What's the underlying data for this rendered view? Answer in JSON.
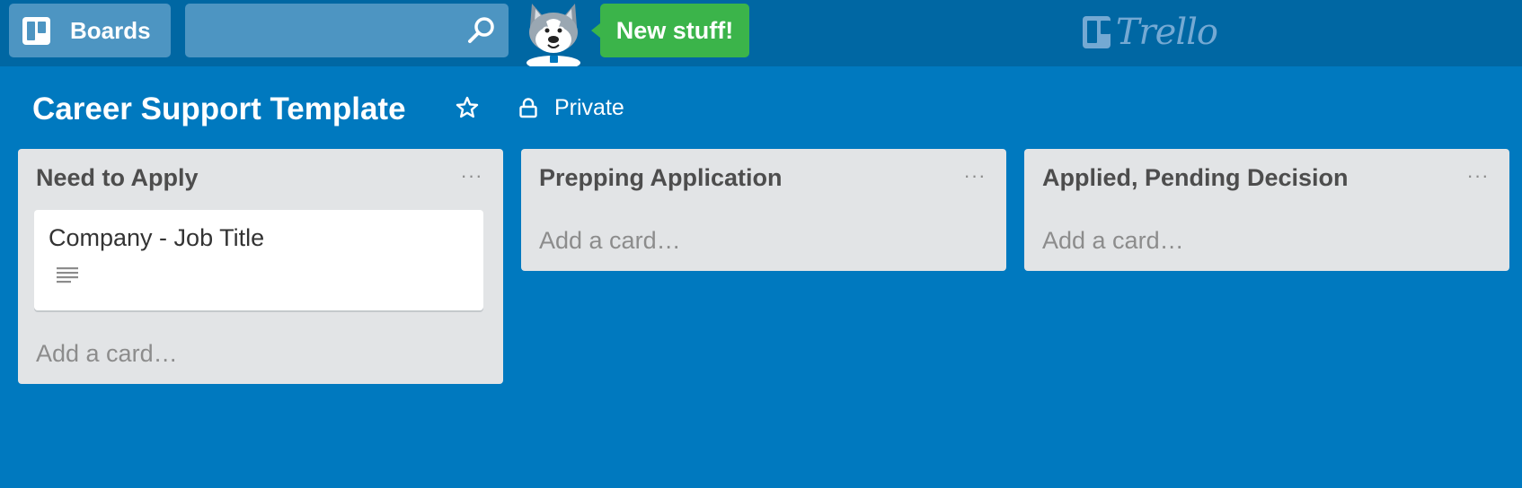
{
  "header": {
    "boards_label": "Boards",
    "search_placeholder": "",
    "new_stuff_label": "New stuff!",
    "logo_text": "Trello"
  },
  "board": {
    "title": "Career Support Template",
    "visibility": "Private"
  },
  "lists": [
    {
      "title": "Need to Apply",
      "menu": "···",
      "cards": [
        {
          "title": "Company - Job Title",
          "has_description": true
        }
      ],
      "add_card": "Add a card…"
    },
    {
      "title": "Prepping Application",
      "menu": "···",
      "cards": [],
      "add_card": "Add a card…"
    },
    {
      "title": "Applied, Pending Decision",
      "menu": "···",
      "cards": [],
      "add_card": "Add a card…"
    }
  ],
  "colors": {
    "board_background": "#0079bf",
    "header_background": "#0067a3",
    "new_stuff_green": "#3bb44a",
    "list_background": "#e2e4e6"
  },
  "icons": [
    "boards-icon",
    "search-icon",
    "mascot-icon",
    "trello-logo-icon",
    "star-icon",
    "lock-icon",
    "list-menu-icon",
    "description-icon"
  ]
}
